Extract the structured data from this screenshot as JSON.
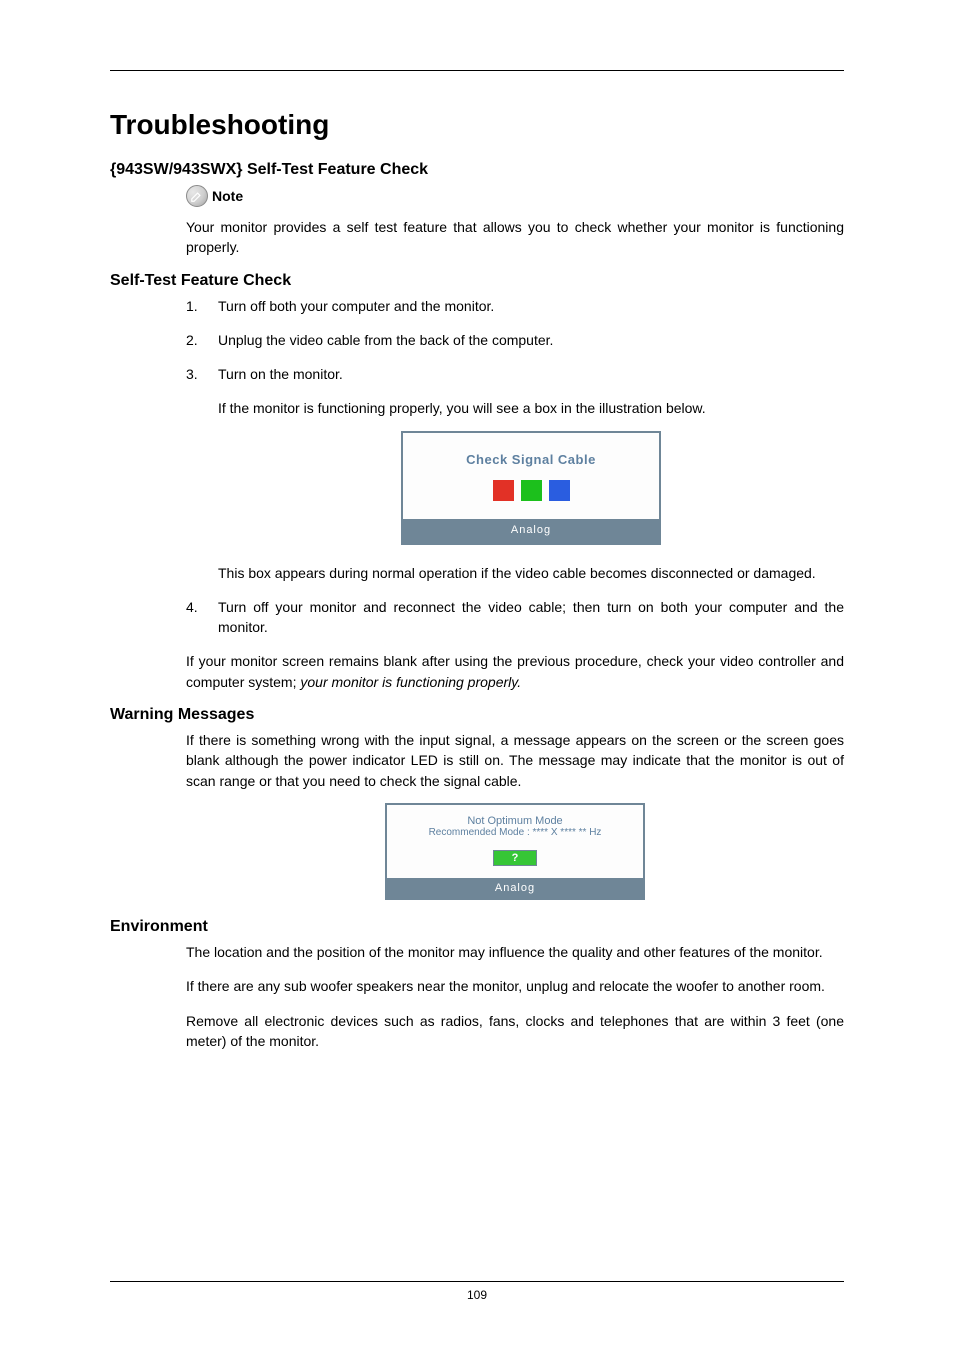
{
  "page": {
    "title": "Troubleshooting",
    "page_number": "109"
  },
  "sec_model": {
    "heading": "{943SW/943SWX} Self-Test Feature Check",
    "note_label": "Note",
    "note_text": "Your monitor provides a self test feature that allows you to check whether your monitor is functioning properly."
  },
  "sec_selftest": {
    "heading": "Self-Test Feature Check",
    "steps": [
      {
        "num": "1.",
        "text": "Turn off both your computer and the monitor."
      },
      {
        "num": "2.",
        "text": "Unplug the video cable from the back of the computer."
      },
      {
        "num": "3.",
        "text": "Turn on the monitor.",
        "sub": "If the monitor is functioning properly, you will see a box in the illustration below.",
        "after_fig": "This box appears during normal operation if the video cable becomes disconnected or damaged."
      },
      {
        "num": "4.",
        "text": "Turn off your monitor and reconnect the video cable; then turn on both your computer and the monitor."
      }
    ],
    "closing_a": "If your monitor screen remains blank after using the previous procedure, check your video controller and computer system; ",
    "closing_b_italic": "your monitor is functioning properly."
  },
  "fig1": {
    "title": "Check Signal Cable",
    "footer": "Analog"
  },
  "sec_warning": {
    "heading": "Warning Messages",
    "text": "If there is something wrong with the input signal, a message appears on the screen or the screen goes blank although the power indicator LED is still on. The message may indicate that the monitor is out of scan range or that you need to check the signal cable."
  },
  "fig2": {
    "line1": "Not Optimum Mode",
    "line2": "Recommended Mode : **** X **** ** Hz",
    "button": "?",
    "footer": "Analog"
  },
  "sec_env": {
    "heading": "Environment",
    "p1": "The location and the position of the monitor may influence the quality and other features of the monitor.",
    "p2": "If there are any sub woofer speakers near the monitor, unplug and relocate the woofer to another room.",
    "p3": "Remove all electronic devices such as radios, fans, clocks and telephones that are within 3 feet (one meter) of the monitor."
  }
}
